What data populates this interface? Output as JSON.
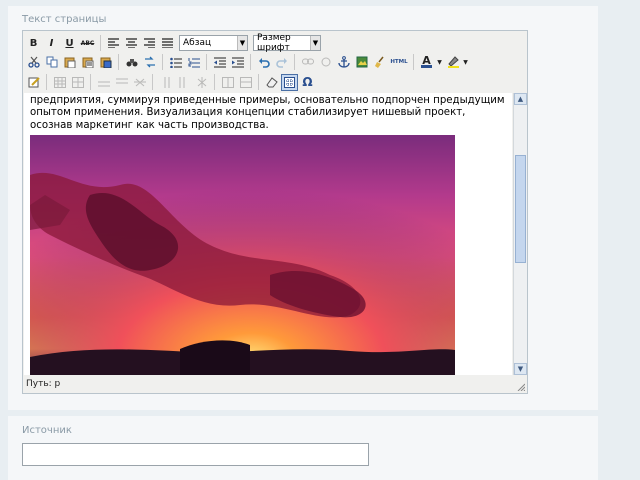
{
  "field_label": "Текст страницы",
  "toolbar": {
    "row1": {
      "bold": "B",
      "italic": "I",
      "underline": "U",
      "strike": "ABC",
      "format_select": "Абзац",
      "fontsize_select": "Размер шрифт"
    },
    "row2": {
      "html_label": "HTML",
      "forecolor": "A"
    },
    "row3": {
      "charmap": "Ω"
    }
  },
  "editor": {
    "paragraph": "предприятия, суммируя приведенные примеры, основательно подпорчен предыдущим опытом применения. Визуализация концепции стабилизирует нишевый проект, осознав маркетинг как часть производства.",
    "path_label": "Путь: p"
  },
  "source_label": "Источник",
  "source_value": "",
  "colors": {
    "background": "#e8eef2",
    "panel": "#f5f7f9",
    "label": "#8a9aa6"
  }
}
